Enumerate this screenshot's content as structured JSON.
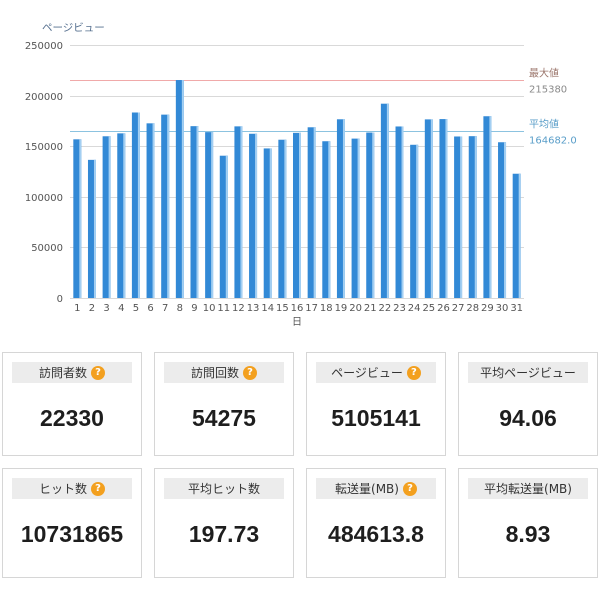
{
  "chart_data": {
    "type": "bar",
    "ylabel": "ページビュー",
    "xlabel": "日",
    "categories": [
      "1",
      "2",
      "3",
      "4",
      "5",
      "6",
      "7",
      "8",
      "9",
      "10",
      "11",
      "12",
      "13",
      "14",
      "15",
      "16",
      "17",
      "18",
      "19",
      "20",
      "21",
      "22",
      "23",
      "24",
      "25",
      "26",
      "27",
      "28",
      "29",
      "30",
      "31"
    ],
    "values": [
      156800,
      136500,
      159800,
      162700,
      183300,
      172600,
      181200,
      215380,
      169800,
      163900,
      140600,
      169600,
      162300,
      147800,
      156400,
      163200,
      168700,
      154900,
      176600,
      157500,
      163500,
      192000,
      169500,
      151400,
      176500,
      176800,
      159600,
      159900,
      179600,
      153900,
      122800
    ],
    "ylim": [
      0,
      250000
    ],
    "yticks": [
      0,
      50000,
      100000,
      150000,
      200000,
      250000
    ],
    "grid": true,
    "bar_color": "#3289d6",
    "bar_highlight_color": "#a3cff2",
    "grid_color": "#d9d9d9",
    "reference_lines": [
      {
        "label": "最大値",
        "value": 215380,
        "value_text": "215380",
        "line_color": "#f0a9a9",
        "label_color": "#9c776d",
        "value_color": "#8a8a8a"
      },
      {
        "label": "平均値",
        "value": 164682.0,
        "value_text": "164682.0",
        "line_color": "#8cc3e0",
        "label_color": "#5a9ec9",
        "value_color": "#5a9ec9"
      }
    ]
  },
  "stats": [
    {
      "label": "訪問者数",
      "value": "22330",
      "icon": "help-icon"
    },
    {
      "label": "訪問回数",
      "value": "54275",
      "icon": "help-icon"
    },
    {
      "label": "ページビュー",
      "value": "5105141",
      "icon": "help-icon"
    },
    {
      "label": "平均ページビュー",
      "value": "94.06",
      "icon": null
    },
    {
      "label": "ヒット数",
      "value": "10731865",
      "icon": "help-icon"
    },
    {
      "label": "平均ヒット数",
      "value": "197.73",
      "icon": null
    },
    {
      "label": "転送量(MB)",
      "value": "484613.8",
      "icon": "help-icon"
    },
    {
      "label": "平均転送量(MB)",
      "value": "8.93",
      "icon": null
    }
  ],
  "colors": {
    "help_icon": "#f3a01f"
  }
}
